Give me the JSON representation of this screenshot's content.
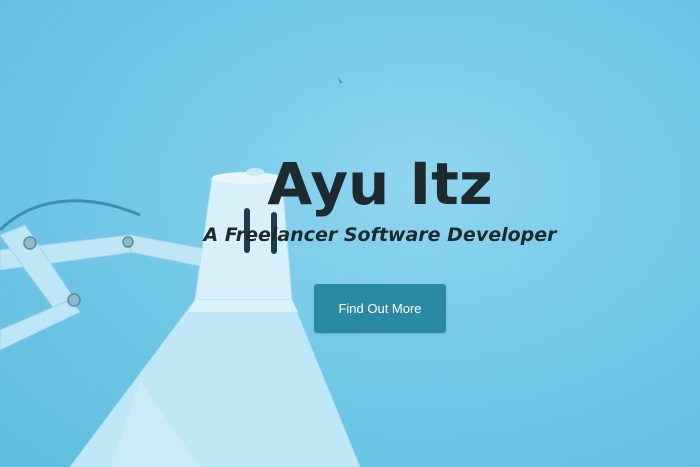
{
  "hero": {
    "title": "Ayu Itz",
    "subtitle": "A Freelancer Software Developer",
    "cta_label": "Find Out More"
  },
  "colors": {
    "background": "#74c9e8",
    "text": "#1f2a2e",
    "button": "#2a8aa3",
    "button_text": "#ffffff"
  }
}
